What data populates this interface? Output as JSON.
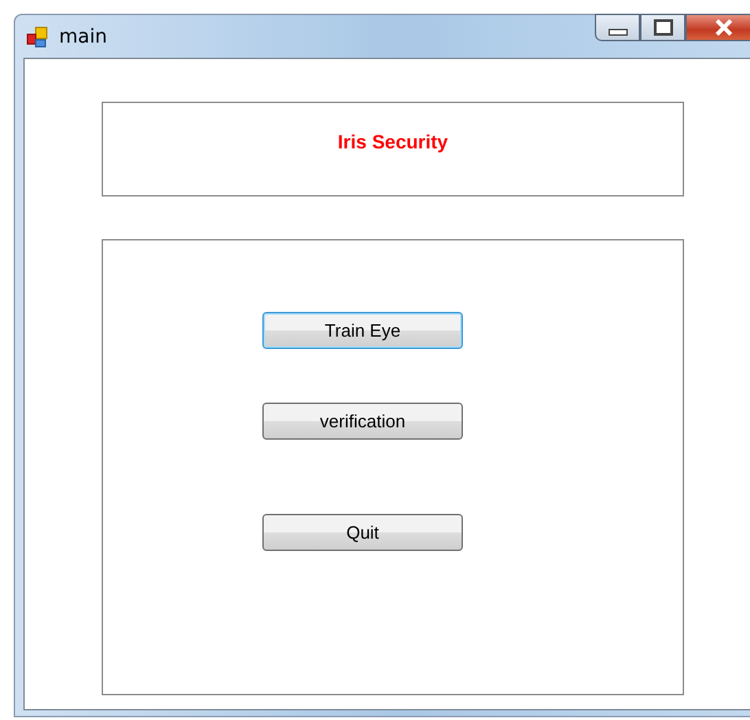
{
  "window": {
    "title": "main"
  },
  "header": {
    "title": "Iris Security"
  },
  "buttons": [
    {
      "label": "Train Eye",
      "focused": true
    },
    {
      "label": "verification",
      "focused": false
    },
    {
      "label": "Quit",
      "focused": false
    }
  ]
}
